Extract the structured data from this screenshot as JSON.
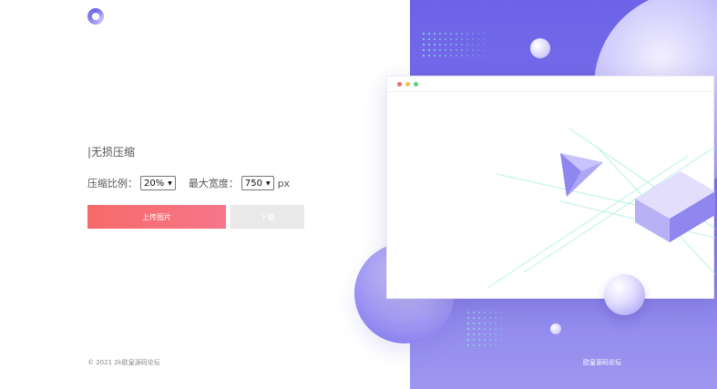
{
  "app": {
    "title": "|无损压缩"
  },
  "options": {
    "ratio_label": "压缩比例：",
    "ratio_value": "20%",
    "width_label": "最大宽度：",
    "width_value": "750",
    "width_unit": "px"
  },
  "buttons": {
    "upload_label": "上传图片",
    "download_label": "下载"
  },
  "footer": {
    "copyright": "© 2021 2k欧皇源码论坛",
    "brand": "欧皇源码论坛"
  },
  "colors": {
    "accent_purple": "#6d63e8",
    "upload_red": "#f76a6a",
    "download_gray": "#e9e9e9"
  },
  "icons": {
    "logo": "ring-logo-icon",
    "select_caret": "caret-down-icon"
  }
}
